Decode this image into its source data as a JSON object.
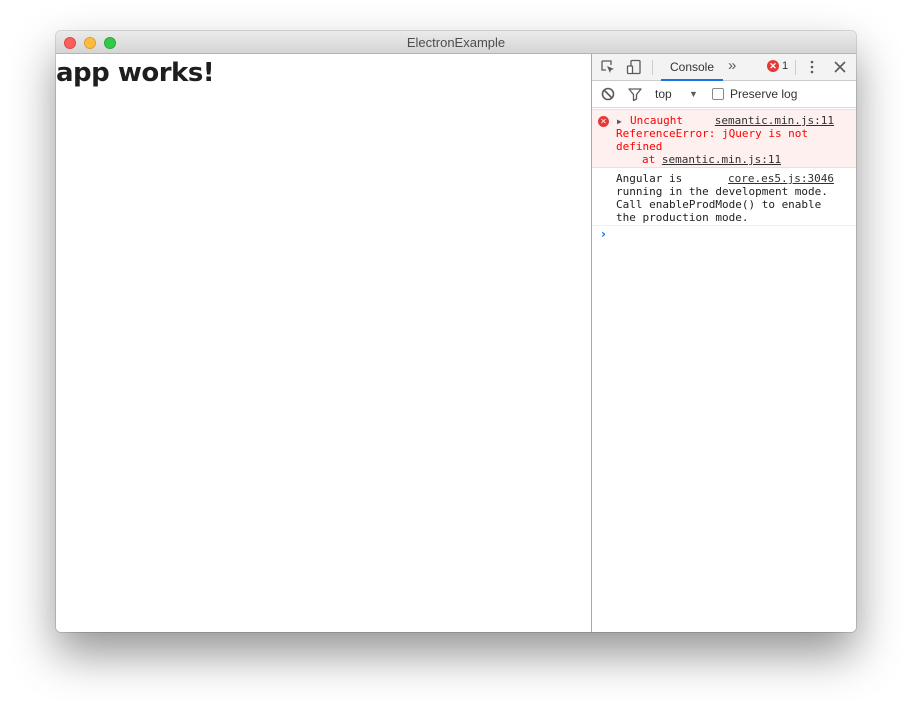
{
  "window": {
    "title": "ElectronExample"
  },
  "app": {
    "heading": "app works!"
  },
  "devtools": {
    "tabs": {
      "active_label": "Console",
      "more_label": "»"
    },
    "error_count": "1",
    "toolbar": {
      "context": "top",
      "context_arrow": "▼",
      "preserve_log_label": "Preserve log",
      "preserve_log_checked": false
    },
    "messages": {
      "error": {
        "icon_glyph": "✕",
        "expand_glyph": "▶",
        "headline": "Uncaught",
        "source": "semantic.min.js:11",
        "body": "ReferenceError: jQuery is not\ndefined",
        "stack_prefix": "at ",
        "stack_source": "semantic.min.js:11"
      },
      "info": {
        "first": "Angular is",
        "source": "core.es5.js:3046",
        "body": "running in the development mode.\nCall enableProdMode() to enable\nthe production mode."
      }
    },
    "prompt_glyph": "›"
  },
  "colors": {
    "error_text": "#ff0000",
    "error_bg": "#fff0f0",
    "accent": "#1a73e8",
    "traffic_close": "#fc605c",
    "traffic_minimize": "#fdbc40",
    "traffic_maximize": "#34c84a"
  },
  "icons": {
    "inspect": "inspect-element-icon",
    "device": "device-toolbar-icon",
    "more_tabs": "more-tabs-icon",
    "error_badge": "error-badge-icon",
    "kebab": "kebab-menu-icon",
    "close": "close-icon",
    "clear": "clear-console-icon",
    "filter": "filter-icon",
    "prompt": "console-prompt-icon"
  }
}
